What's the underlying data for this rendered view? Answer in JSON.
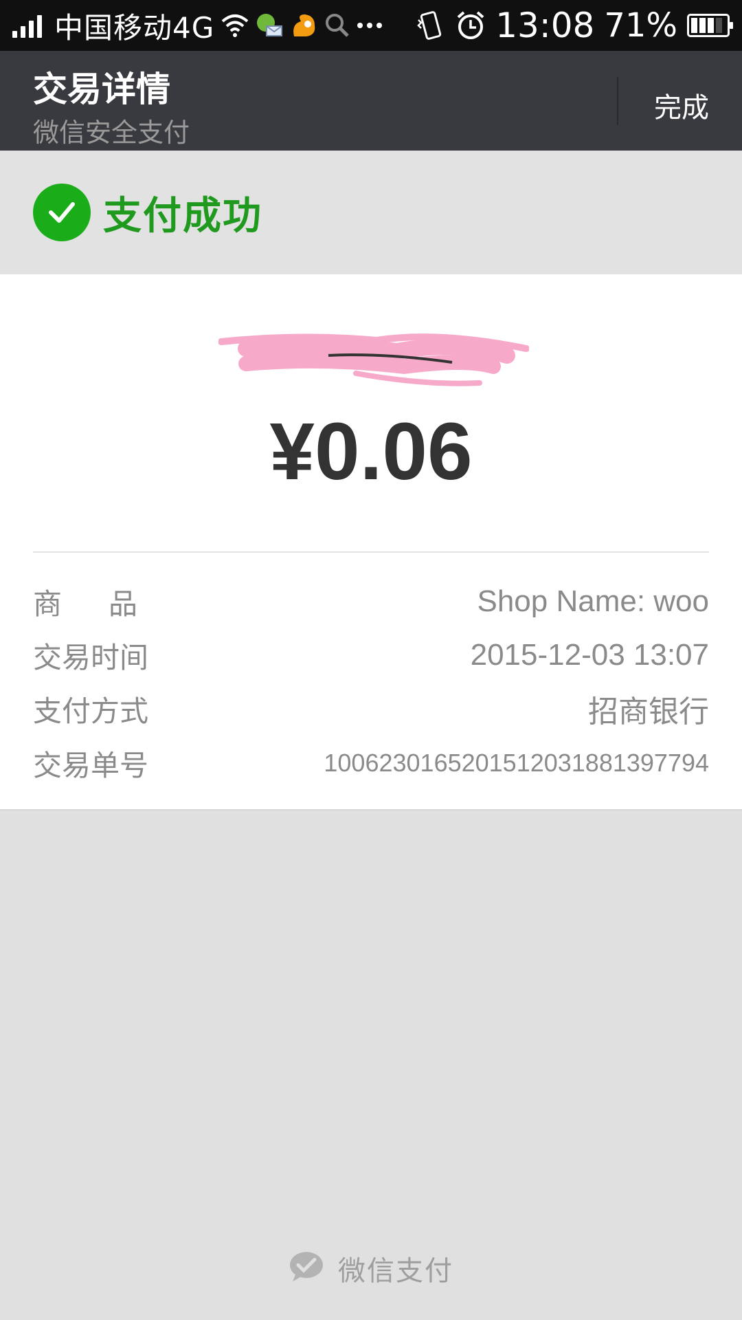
{
  "status_bar": {
    "carrier": "中国移动4G",
    "time": "13:08",
    "battery_percent": "71%"
  },
  "nav": {
    "title": "交易详情",
    "subtitle": "微信安全支付",
    "done_label": "完成"
  },
  "status": {
    "message": "支付成功",
    "icon": "check-circle-icon",
    "color": "#1aad19"
  },
  "payment": {
    "amount": "¥0.06"
  },
  "details": {
    "product_label": "商品",
    "product_value": "Shop Name: woo",
    "time_label": "交易时间",
    "time_value": "2015-12-03 13:07",
    "method_label": "支付方式",
    "method_value": "招商银行",
    "order_label": "交易单号",
    "order_value": "1006230165201512031881397794"
  },
  "footer": {
    "brand": "微信支付",
    "icon": "wechat-pay-icon"
  },
  "colors": {
    "nav_bg": "#393a3f",
    "success_green": "#1aad19",
    "page_bg": "#e0e0e0"
  }
}
